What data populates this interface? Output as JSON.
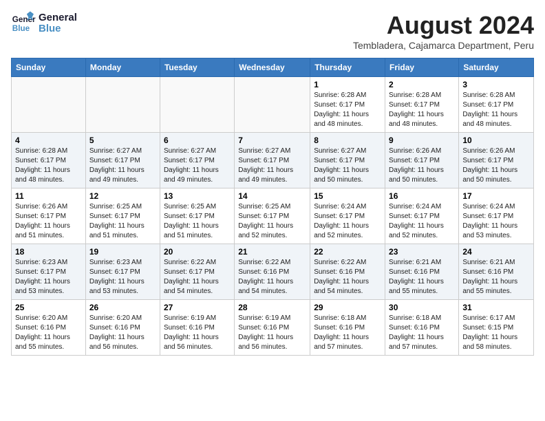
{
  "logo": {
    "line1": "General",
    "line2": "Blue"
  },
  "title": "August 2024",
  "subtitle": "Tembladera, Cajamarca Department, Peru",
  "days_of_week": [
    "Sunday",
    "Monday",
    "Tuesday",
    "Wednesday",
    "Thursday",
    "Friday",
    "Saturday"
  ],
  "weeks": [
    [
      {
        "day": "",
        "info": ""
      },
      {
        "day": "",
        "info": ""
      },
      {
        "day": "",
        "info": ""
      },
      {
        "day": "",
        "info": ""
      },
      {
        "day": "1",
        "info": "Sunrise: 6:28 AM\nSunset: 6:17 PM\nDaylight: 11 hours\nand 48 minutes."
      },
      {
        "day": "2",
        "info": "Sunrise: 6:28 AM\nSunset: 6:17 PM\nDaylight: 11 hours\nand 48 minutes."
      },
      {
        "day": "3",
        "info": "Sunrise: 6:28 AM\nSunset: 6:17 PM\nDaylight: 11 hours\nand 48 minutes."
      }
    ],
    [
      {
        "day": "4",
        "info": "Sunrise: 6:28 AM\nSunset: 6:17 PM\nDaylight: 11 hours\nand 48 minutes."
      },
      {
        "day": "5",
        "info": "Sunrise: 6:27 AM\nSunset: 6:17 PM\nDaylight: 11 hours\nand 49 minutes."
      },
      {
        "day": "6",
        "info": "Sunrise: 6:27 AM\nSunset: 6:17 PM\nDaylight: 11 hours\nand 49 minutes."
      },
      {
        "day": "7",
        "info": "Sunrise: 6:27 AM\nSunset: 6:17 PM\nDaylight: 11 hours\nand 49 minutes."
      },
      {
        "day": "8",
        "info": "Sunrise: 6:27 AM\nSunset: 6:17 PM\nDaylight: 11 hours\nand 50 minutes."
      },
      {
        "day": "9",
        "info": "Sunrise: 6:26 AM\nSunset: 6:17 PM\nDaylight: 11 hours\nand 50 minutes."
      },
      {
        "day": "10",
        "info": "Sunrise: 6:26 AM\nSunset: 6:17 PM\nDaylight: 11 hours\nand 50 minutes."
      }
    ],
    [
      {
        "day": "11",
        "info": "Sunrise: 6:26 AM\nSunset: 6:17 PM\nDaylight: 11 hours\nand 51 minutes."
      },
      {
        "day": "12",
        "info": "Sunrise: 6:25 AM\nSunset: 6:17 PM\nDaylight: 11 hours\nand 51 minutes."
      },
      {
        "day": "13",
        "info": "Sunrise: 6:25 AM\nSunset: 6:17 PM\nDaylight: 11 hours\nand 51 minutes."
      },
      {
        "day": "14",
        "info": "Sunrise: 6:25 AM\nSunset: 6:17 PM\nDaylight: 11 hours\nand 52 minutes."
      },
      {
        "day": "15",
        "info": "Sunrise: 6:24 AM\nSunset: 6:17 PM\nDaylight: 11 hours\nand 52 minutes."
      },
      {
        "day": "16",
        "info": "Sunrise: 6:24 AM\nSunset: 6:17 PM\nDaylight: 11 hours\nand 52 minutes."
      },
      {
        "day": "17",
        "info": "Sunrise: 6:24 AM\nSunset: 6:17 PM\nDaylight: 11 hours\nand 53 minutes."
      }
    ],
    [
      {
        "day": "18",
        "info": "Sunrise: 6:23 AM\nSunset: 6:17 PM\nDaylight: 11 hours\nand 53 minutes."
      },
      {
        "day": "19",
        "info": "Sunrise: 6:23 AM\nSunset: 6:17 PM\nDaylight: 11 hours\nand 53 minutes."
      },
      {
        "day": "20",
        "info": "Sunrise: 6:22 AM\nSunset: 6:17 PM\nDaylight: 11 hours\nand 54 minutes."
      },
      {
        "day": "21",
        "info": "Sunrise: 6:22 AM\nSunset: 6:16 PM\nDaylight: 11 hours\nand 54 minutes."
      },
      {
        "day": "22",
        "info": "Sunrise: 6:22 AM\nSunset: 6:16 PM\nDaylight: 11 hours\nand 54 minutes."
      },
      {
        "day": "23",
        "info": "Sunrise: 6:21 AM\nSunset: 6:16 PM\nDaylight: 11 hours\nand 55 minutes."
      },
      {
        "day": "24",
        "info": "Sunrise: 6:21 AM\nSunset: 6:16 PM\nDaylight: 11 hours\nand 55 minutes."
      }
    ],
    [
      {
        "day": "25",
        "info": "Sunrise: 6:20 AM\nSunset: 6:16 PM\nDaylight: 11 hours\nand 55 minutes."
      },
      {
        "day": "26",
        "info": "Sunrise: 6:20 AM\nSunset: 6:16 PM\nDaylight: 11 hours\nand 56 minutes."
      },
      {
        "day": "27",
        "info": "Sunrise: 6:19 AM\nSunset: 6:16 PM\nDaylight: 11 hours\nand 56 minutes."
      },
      {
        "day": "28",
        "info": "Sunrise: 6:19 AM\nSunset: 6:16 PM\nDaylight: 11 hours\nand 56 minutes."
      },
      {
        "day": "29",
        "info": "Sunrise: 6:18 AM\nSunset: 6:16 PM\nDaylight: 11 hours\nand 57 minutes."
      },
      {
        "day": "30",
        "info": "Sunrise: 6:18 AM\nSunset: 6:16 PM\nDaylight: 11 hours\nand 57 minutes."
      },
      {
        "day": "31",
        "info": "Sunrise: 6:17 AM\nSunset: 6:15 PM\nDaylight: 11 hours\nand 58 minutes."
      }
    ]
  ]
}
